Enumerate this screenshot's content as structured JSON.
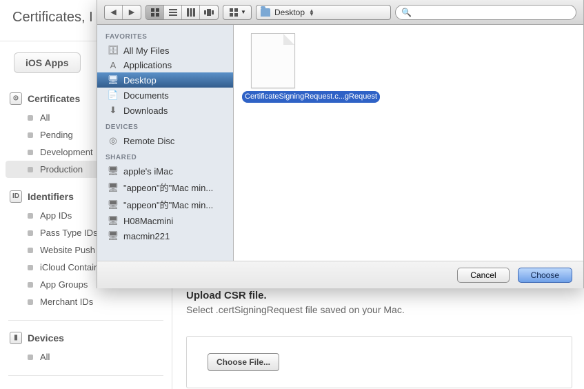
{
  "app": {
    "header_title": "Certificates, I",
    "apps_tab": "iOS Apps",
    "sections": [
      {
        "title": "Certificates",
        "icon": "⊙",
        "items": [
          "All",
          "Pending",
          "Development",
          "Production"
        ],
        "selected_index": 3
      },
      {
        "title": "Identifiers",
        "icon": "ID",
        "items": [
          "App IDs",
          "Pass Type IDs",
          "Website Push IDs",
          "iCloud Containers",
          "App Groups",
          "Merchant IDs"
        ],
        "selected_index": -1
      },
      {
        "title": "Devices",
        "icon": "▮",
        "items": [
          "All"
        ],
        "selected_index": -1
      }
    ]
  },
  "main": {
    "title": "Upload CSR file.",
    "subtitle_a": "Select .certSigningRequest file saved on your Mac.",
    "choose_file": "Choose File..."
  },
  "dialog": {
    "location_label": "Desktop",
    "search_placeholder": "",
    "sidebar": {
      "favorites_label": "FAVORITES",
      "favorites": [
        "All My Files",
        "Applications",
        "Desktop",
        "Documents",
        "Downloads"
      ],
      "favorites_selected": 2,
      "devices_label": "DEVICES",
      "devices": [
        "Remote Disc"
      ],
      "shared_label": "SHARED",
      "shared": [
        " apple's iMac",
        "\"appeon\"的\"Mac min...",
        "\"appeon\"的\"Mac min...",
        "H08Macmini",
        "macmin221"
      ]
    },
    "file": {
      "name": "CertificateSigningRequest.c...gRequest"
    },
    "cancel": "Cancel",
    "choose": "Choose"
  }
}
